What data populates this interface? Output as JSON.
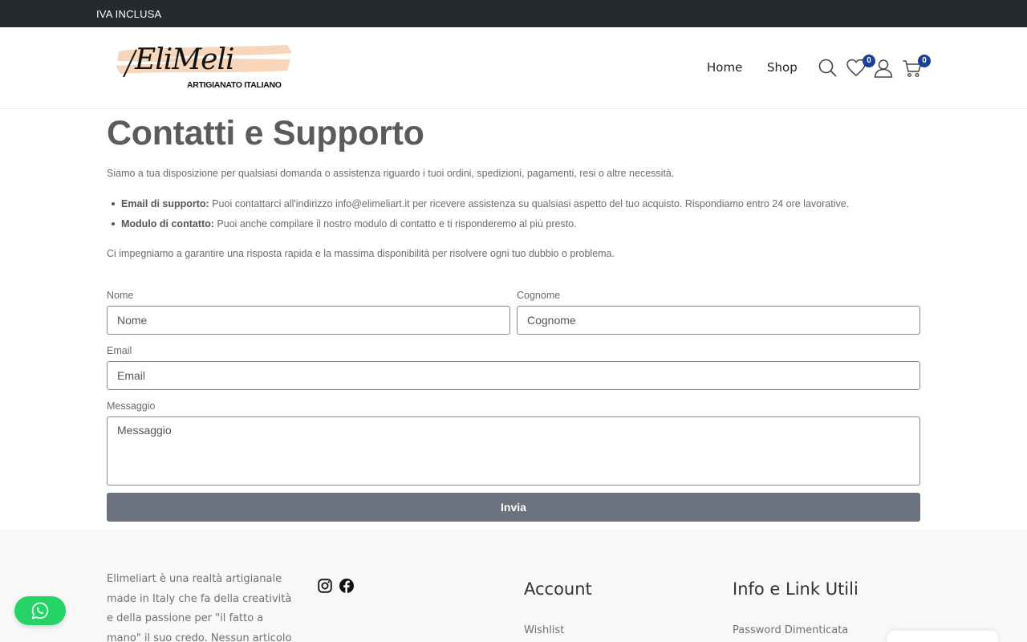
{
  "topbar": {
    "text": "IVA INCLUSA"
  },
  "header": {
    "logo": {
      "name": "EliMeli",
      "tagline": "ARTIGIANATO ITALIANO"
    },
    "nav": [
      {
        "label": "Home"
      },
      {
        "label": "Shop"
      }
    ],
    "wishlist_count": "0",
    "cart_count": "0",
    "icons": [
      "search-icon",
      "heart-icon",
      "user-icon",
      "cart-icon"
    ]
  },
  "main": {
    "title": "Contatti e Supporto",
    "intro": "Siamo a tua disposizione per qualsiasi domanda o assistenza riguardo i tuoi ordini, spedizioni, pagamenti, resi o altre necessità.",
    "bullets": [
      {
        "label": "Email di supporto:",
        "text": " Puoi contattarci all'indirizzo info@elimeliart.it per ricevere assistenza su qualsiasi aspetto del tuo acquisto. Rispondiamo entro 24 ore lavorative."
      },
      {
        "label": "Modulo di contatto:",
        "text": " Puoi anche compilare il nostro modulo di contatto e ti risponderemo al più presto."
      }
    ],
    "outro": "Ci impegniamo a garantire una risposta rapida e la massima disponibilità per risolvere ogni tuo dubbio o problema."
  },
  "form": {
    "nome": {
      "label": "Nome",
      "placeholder": "Nome"
    },
    "cognome": {
      "label": "Cognome",
      "placeholder": "Cognome"
    },
    "email": {
      "label": "Email",
      "placeholder": "Email"
    },
    "messaggio": {
      "label": "Messaggio",
      "placeholder": "Messaggio"
    },
    "submit": "Invia"
  },
  "footer": {
    "about": "Elimeliart è una realtà artigianale made in Italy che fa della creatività e della passione per \"il fatto a mano\" il suo credo. Nessun articolo sarà mai",
    "social": [
      "instagram-icon",
      "facebook-icon"
    ],
    "account": {
      "heading": "Account",
      "links": [
        "Wishlist"
      ]
    },
    "info": {
      "heading": "Info e Link Utili",
      "links": [
        "Password Dimenticata"
      ]
    }
  },
  "colors": {
    "topbar": "#262a2e",
    "badge": "#1b3f93",
    "button": "#69727d",
    "whatsapp": "#25d366",
    "logo_brush": "#f7d6bb"
  }
}
